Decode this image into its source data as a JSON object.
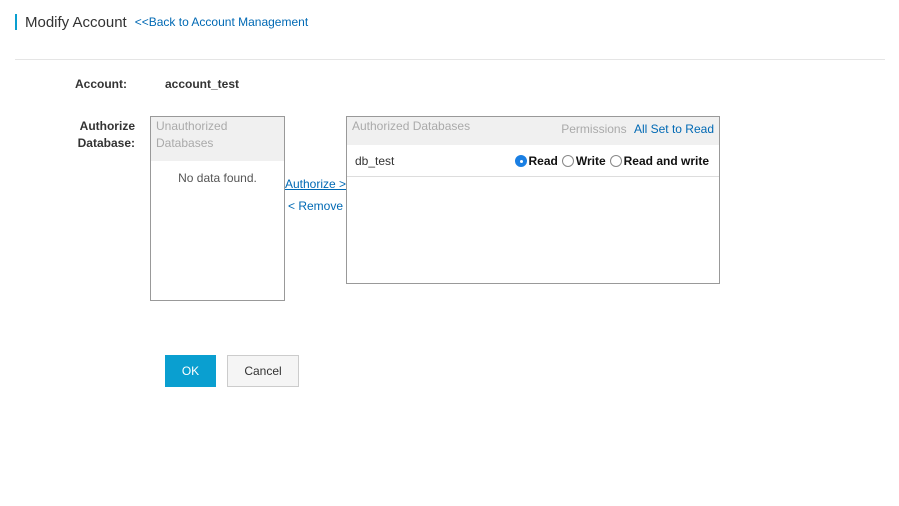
{
  "header": {
    "title": "Modify Account",
    "back_link": "<<Back to Account Management"
  },
  "form": {
    "account_label": "Account:",
    "account_value": "account_test",
    "authorize_label_line1": "Authorize",
    "authorize_label_line2": "Database:"
  },
  "unauthorized": {
    "header_line1": "Unauthorized",
    "header_line2": "Databases",
    "empty_message": "No data found."
  },
  "transfer": {
    "authorize": "Authorize >",
    "remove": "< Remove"
  },
  "authorized": {
    "header": "Authorized Databases",
    "permissions_label": "Permissions",
    "all_set_read": "All Set to Read",
    "rows": [
      {
        "name": "db_test",
        "options": [
          "Read",
          "Write",
          "Read and write"
        ],
        "selected": "Read"
      }
    ]
  },
  "buttons": {
    "ok": "OK",
    "cancel": "Cancel"
  },
  "colors": {
    "accent": "#0a9fd0",
    "link": "#0069b4"
  }
}
